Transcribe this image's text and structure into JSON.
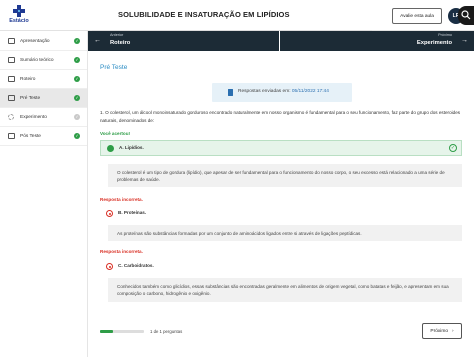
{
  "header": {
    "logo_text": "Estácio",
    "title": "SOLUBILIDADE E INSATURAÇÃO EM LIPÍDIOS",
    "help_button": "Avalie esta aula",
    "avatar_initials": "LR"
  },
  "sidebar": {
    "items": [
      {
        "label": "Apresentação",
        "done": true
      },
      {
        "label": "Sumário teórico",
        "done": true
      },
      {
        "label": "Roteiro",
        "done": true
      },
      {
        "label": "Pré Teste",
        "done": true,
        "active": true
      },
      {
        "label": "Experimento",
        "done": false
      },
      {
        "label": "Pós Teste",
        "done": true
      }
    ]
  },
  "nav": {
    "prev_small": "Anterior",
    "prev_big": "Roteiro",
    "next_small": "Próximo",
    "next_big": "Experimento"
  },
  "main": {
    "section_title": "Pré Teste",
    "sent_label": "Respostas enviadas em:",
    "sent_date": "05/11/2022 17:44",
    "question": "1. O colesterol, um álcool monoinsaturado gorduroso encontrado naturalmente em nosso organismo é fundamental para o seu funcionamento, faz parte do grupo dos esteroides naturais, denominados de:",
    "correct_label": "Você acertou!",
    "answer1": "A. Lipídios.",
    "explain1": "O colesterol é um tipo de gordura (lipídio), que apesar de ser fundamental para o funcionamento do nosso corpo, o seu excesso está relacionado a uma série de problemas de saúde.",
    "wrong_label_1": "Resposta incorreta.",
    "answer2": "B. Proteínas.",
    "explain2": "As proteínas são substâncias formadas por um conjunto de aminoácidos ligados entre si através de ligações peptídicas.",
    "wrong_label_2": "Resposta incorreta.",
    "answer3": "C. Carboidratos.",
    "explain3": "Conhecidos também como glicídios, essas substâncias são encontradas geralmente em alimentos de origem vegetal, como batatas e feijão, e apresentam em sua composição o carbono, hidrogênio e oxigênio.",
    "progress_text": "1 de 1 perguntas",
    "progress_fraction": 0.3,
    "next_button": "Próximo"
  },
  "colors": {
    "accent_blue": "#2b8cc4",
    "nav_dark": "#1c2b36",
    "success_green": "#2e9d47",
    "error_red": "#d93025"
  }
}
